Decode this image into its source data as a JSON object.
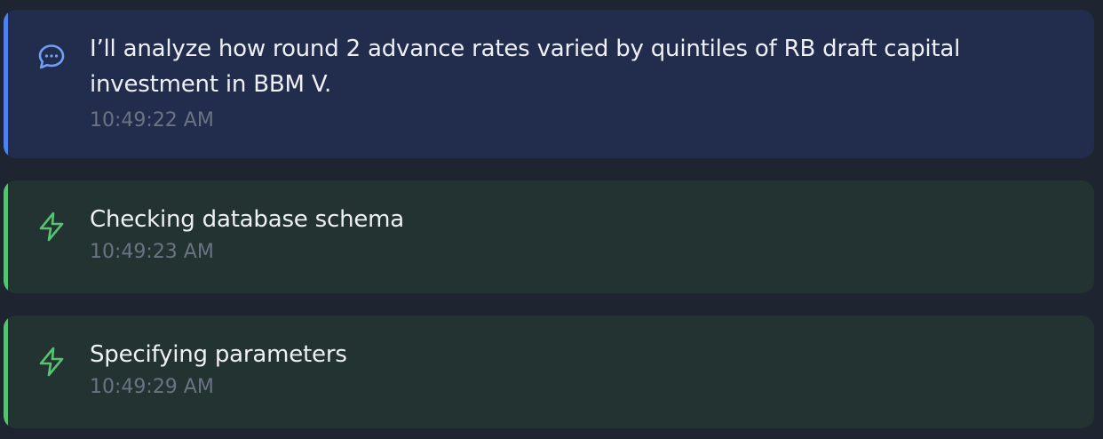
{
  "colors": {
    "background": "#1e2430",
    "message_card": "#222d4d",
    "message_accent": "#4f82ee",
    "action_card": "#233332",
    "action_accent": "#56c272",
    "text": "#eef0f5",
    "timestamp": "#6b7383"
  },
  "feed": {
    "items": [
      {
        "kind": "message",
        "icon": "chat-bubble-icon",
        "text": "I’ll analyze how round 2 advance rates varied by quintiles of RB draft capital investment in BBM V.",
        "time": "10:49:22 AM"
      },
      {
        "kind": "action",
        "icon": "lightning-bolt-icon",
        "text": "Checking database schema",
        "time": "10:49:23 AM"
      },
      {
        "kind": "action",
        "icon": "lightning-bolt-icon",
        "text": "Specifying parameters",
        "time": "10:49:29 AM"
      }
    ]
  }
}
